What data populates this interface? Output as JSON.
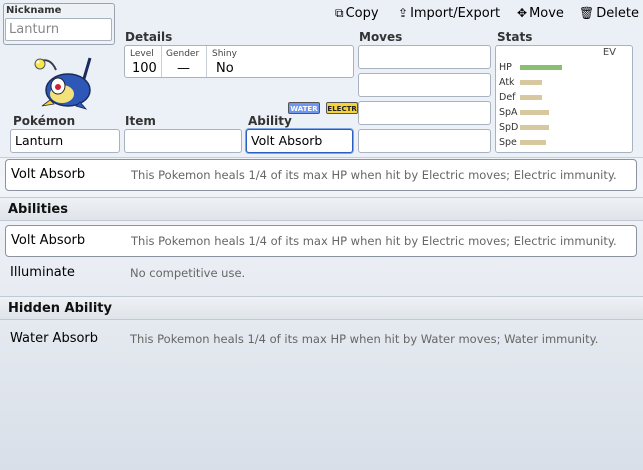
{
  "nickname": {
    "label": "Nickname",
    "placeholder": "Lanturn"
  },
  "toolbar": {
    "copy": "Copy",
    "import_export": "Import/Export",
    "move": "Move",
    "delete": "Delete"
  },
  "details": {
    "label": "Details",
    "level_label": "Level",
    "level": "100",
    "gender_label": "Gender",
    "gender": "—",
    "shiny_label": "Shiny",
    "shiny": "No"
  },
  "types": [
    "WATER",
    "ELECTR"
  ],
  "fields": {
    "pokemon_label": "Pokémon",
    "pokemon": "Lanturn",
    "item_label": "Item",
    "item": "",
    "ability_label": "Ability",
    "ability": "Volt Absorb"
  },
  "moves": {
    "label": "Moves",
    "values": [
      "",
      "",
      "",
      ""
    ]
  },
  "stats": {
    "label": "Stats",
    "ev_label": "EV",
    "rows": [
      {
        "name": "HP",
        "level": 0.42,
        "color": "#88c070"
      },
      {
        "name": "Atk",
        "level": 0.22,
        "color": "#d8c8a0"
      },
      {
        "name": "Def",
        "level": 0.22,
        "color": "#d8c8a0"
      },
      {
        "name": "SpA",
        "level": 0.29,
        "color": "#d8c8a0"
      },
      {
        "name": "SpD",
        "level": 0.29,
        "color": "#d8c8a0"
      },
      {
        "name": "Spe",
        "level": 0.26,
        "color": "#d8c8a0"
      }
    ]
  },
  "selected_ability": {
    "name": "Volt Absorb",
    "desc": "This Pokemon heals 1/4 of its max HP when hit by Electric moves; Electric immunity."
  },
  "abilities_section": {
    "title": "Abilities",
    "items": [
      {
        "name": "Volt Absorb",
        "desc": "This Pokemon heals 1/4 of its max HP when hit by Electric moves; Electric immunity."
      },
      {
        "name": "Illuminate",
        "desc": "No competitive use."
      }
    ]
  },
  "hidden_section": {
    "title": "Hidden Ability",
    "items": [
      {
        "name": "Water Absorb",
        "desc": "This Pokemon heals 1/4 of its max HP when hit by Water moves; Water immunity."
      }
    ]
  }
}
